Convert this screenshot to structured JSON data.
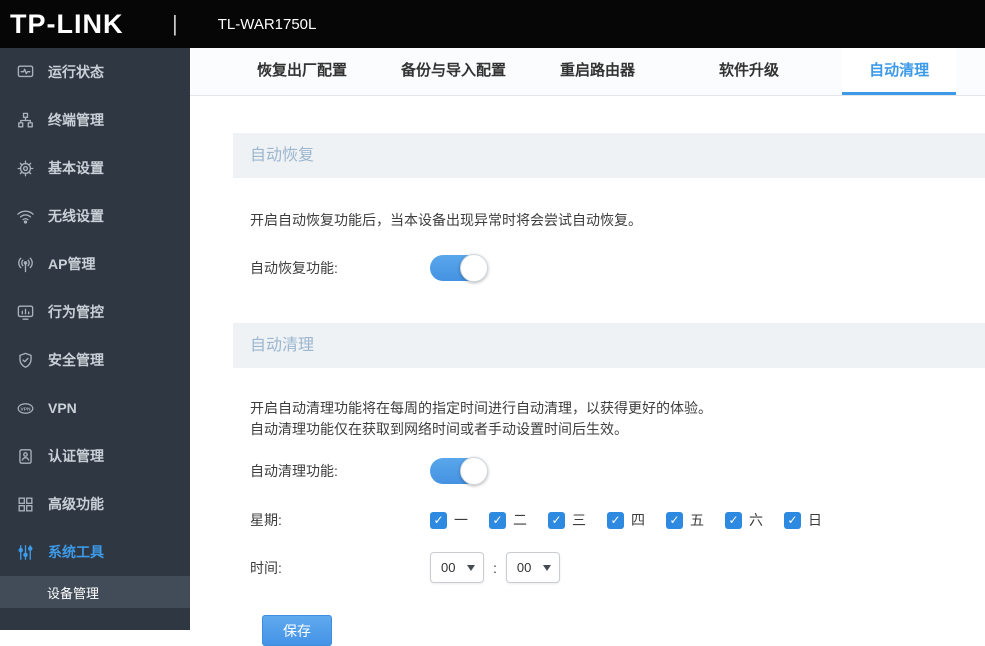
{
  "header": {
    "logo": "TP-LINK",
    "separator": "|",
    "model": "TL-WAR1750L"
  },
  "sidebar": {
    "items": [
      {
        "label": "运行状态",
        "icon": "monitor-pulse-icon",
        "active": false
      },
      {
        "label": "终端管理",
        "icon": "network-topology-icon",
        "active": false
      },
      {
        "label": "基本设置",
        "icon": "gear-icon",
        "active": false
      },
      {
        "label": "无线设置",
        "icon": "wifi-icon",
        "active": false
      },
      {
        "label": "AP管理",
        "icon": "antenna-icon",
        "active": false
      },
      {
        "label": "行为管控",
        "icon": "behavior-monitor-icon",
        "active": false
      },
      {
        "label": "安全管理",
        "icon": "shield-icon",
        "active": false
      },
      {
        "label": "VPN",
        "icon": "vpn-icon",
        "active": false
      },
      {
        "label": "认证管理",
        "icon": "id-badge-icon",
        "active": false
      },
      {
        "label": "高级功能",
        "icon": "grid-squares-icon",
        "active": false
      },
      {
        "label": "系统工具",
        "icon": "sliders-icon",
        "active": true
      }
    ],
    "subitem": {
      "label": "设备管理",
      "active": true
    }
  },
  "tabs": [
    {
      "label": "恢复出厂配置",
      "active": false
    },
    {
      "label": "备份与导入配置",
      "active": false
    },
    {
      "label": "重启路由器",
      "active": false
    },
    {
      "label": "软件升级",
      "active": false
    },
    {
      "label": "自动清理",
      "active": true
    }
  ],
  "auto_recovery": {
    "title": "自动恢复",
    "description": "开启自动恢复功能后，当本设备出现异常时将会尝试自动恢复。",
    "toggle_label": "自动恢复功能:",
    "toggle_state": "on"
  },
  "auto_clean": {
    "title": "自动清理",
    "description_line1": "开启自动清理功能将在每周的指定时间进行自动清理，以获得更好的体验。",
    "description_line2": "自动清理功能仅在获取到网络时间或者手动设置时间后生效。",
    "toggle_label": "自动清理功能:",
    "toggle_state": "on",
    "week_label": "星期:",
    "weekdays": [
      {
        "label": "一",
        "checked": true
      },
      {
        "label": "二",
        "checked": true
      },
      {
        "label": "三",
        "checked": true
      },
      {
        "label": "四",
        "checked": true
      },
      {
        "label": "五",
        "checked": true
      },
      {
        "label": "六",
        "checked": true
      },
      {
        "label": "日",
        "checked": true
      }
    ],
    "time_label": "时间:",
    "hour_value": "00",
    "time_separator": ":",
    "minute_value": "00",
    "save_button": "保存"
  },
  "colors": {
    "accent": "#3d9ae8",
    "sidebar_background": "#2e3742",
    "section_header_background": "#eef2f5"
  }
}
